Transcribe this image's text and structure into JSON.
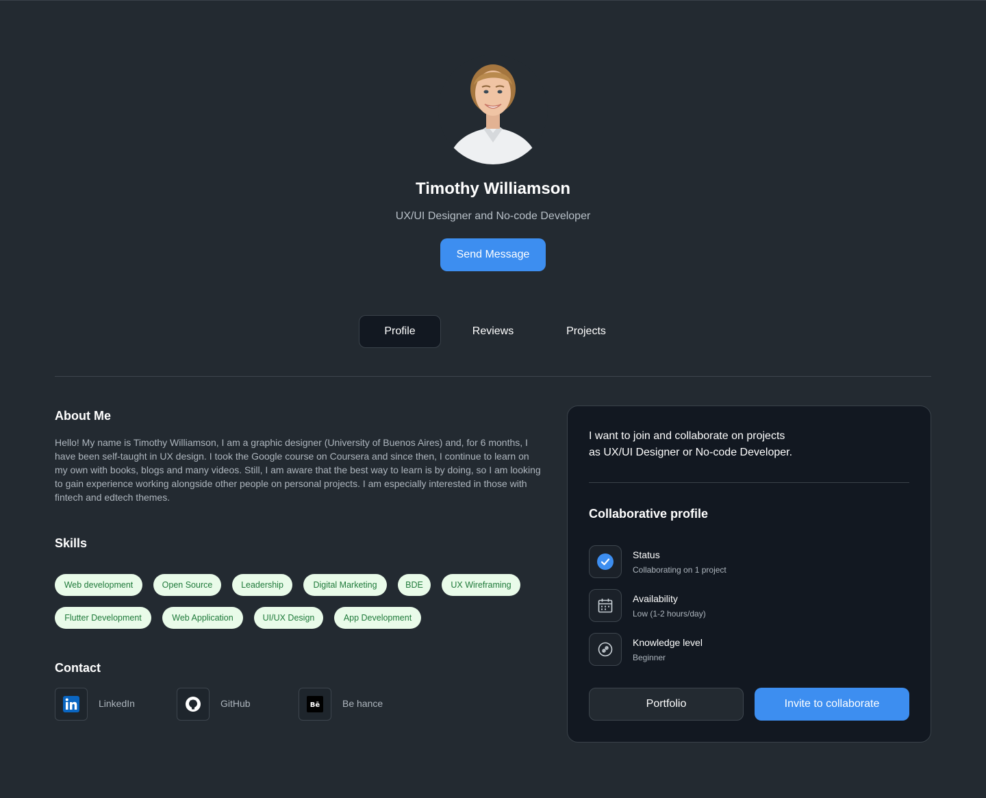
{
  "profile": {
    "name": "Timothy Williamson",
    "role": "UX/UI Designer and No-code Developer",
    "send_message_label": "Send Message"
  },
  "tabs": [
    {
      "label": "Profile",
      "active": true
    },
    {
      "label": "Reviews",
      "active": false
    },
    {
      "label": "Projects",
      "active": false
    }
  ],
  "about": {
    "title": "About Me",
    "text": "Hello! My name is Timothy Williamson, I am a graphic designer (University of Buenos Aires) and, for 6 months, I have been self-taught in UX design. I took the Google course on Coursera and since then, I continue to learn on my own with books, blogs and many videos. Still, I am aware that the best way to learn is by doing, so I am looking to gain experience working alongside other people on personal projects. I am especially interested in those with fintech and edtech themes."
  },
  "skills": {
    "title": "Skills",
    "items": [
      "Web development",
      "Open Source",
      "Leadership",
      "Digital Marketing",
      "BDE",
      "UX Wireframing",
      "Flutter Development",
      "Web Application",
      "UI/UX Design",
      "App Development"
    ]
  },
  "contact": {
    "title": "Contact",
    "items": [
      {
        "label": "LinkedIn",
        "icon": "linkedin-icon"
      },
      {
        "label": "GitHub",
        "icon": "github-icon"
      },
      {
        "label": "Be hance",
        "icon": "behance-icon"
      }
    ]
  },
  "collab_card": {
    "intro_line1": "I want to join and collaborate on projects",
    "intro_line2": "as UX/UI Designer or No-code Developer.",
    "title": "Collaborative profile",
    "rows": [
      {
        "label": "Status",
        "value": "Collaborating on 1 project",
        "icon": "check-circle-icon"
      },
      {
        "label": "Availability",
        "value": "Low (1-2 hours/day)",
        "icon": "calendar-icon"
      },
      {
        "label": "Knowledge level",
        "value": "Beginner",
        "icon": "skill-level-icon"
      }
    ],
    "portfolio_label": "Portfolio",
    "invite_label": "Invite to collaborate"
  },
  "colors": {
    "background": "#232a31",
    "card": "#121821",
    "accent": "#3d8ef0",
    "chip_bg": "#e9fbe9",
    "chip_text": "#1f7a3a"
  }
}
